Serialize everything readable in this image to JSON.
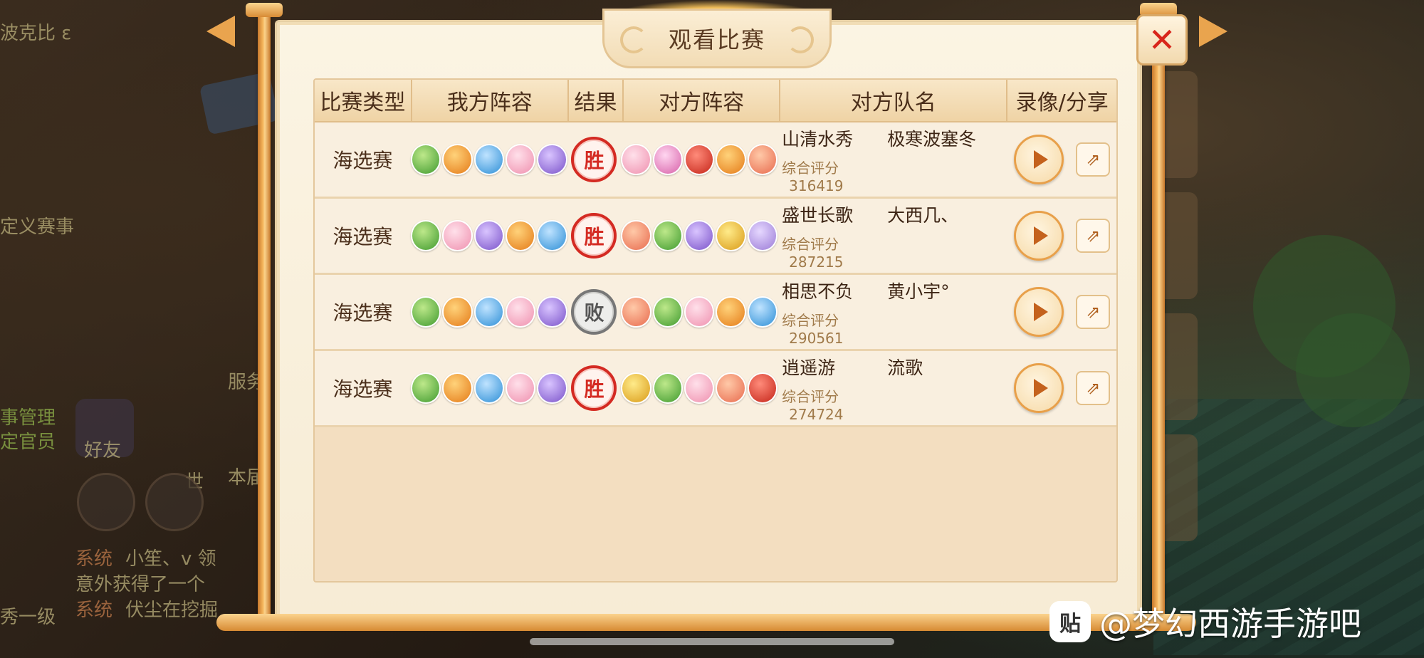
{
  "dialog": {
    "title": "观看比赛",
    "close_label": "✕"
  },
  "table": {
    "headers": [
      "比赛类型",
      "我方阵容",
      "结果",
      "对方阵容",
      "对方队名",
      "录像/分享"
    ],
    "rows": [
      {
        "type": "海选赛",
        "my_team": [
          "green",
          "orange",
          "blue",
          "pink",
          "purple"
        ],
        "result": "胜",
        "opp_team": [
          "pink",
          "magenta",
          "red",
          "orange",
          "salmon"
        ],
        "opp_player1": "山清水秀",
        "opp_player2": "极寒波塞冬",
        "score_label": "综合评分",
        "score": "316419"
      },
      {
        "type": "海选赛",
        "my_team": [
          "green",
          "pink",
          "purple",
          "orange",
          "blue"
        ],
        "result": "胜",
        "opp_team": [
          "salmon",
          "green",
          "purple",
          "yellow",
          "violet"
        ],
        "opp_player1": "盛世长歌",
        "opp_player2": "大西几、",
        "score_label": "综合评分",
        "score": "287215"
      },
      {
        "type": "海选赛",
        "my_team": [
          "green",
          "orange",
          "blue",
          "pink",
          "purple"
        ],
        "result": "败",
        "opp_team": [
          "salmon",
          "green",
          "pink",
          "orange",
          "blue"
        ],
        "opp_player1": "相思不负",
        "opp_player2": "黄小宇°",
        "score_label": "综合评分",
        "score": "290561"
      },
      {
        "type": "海选赛",
        "my_team": [
          "green",
          "orange",
          "blue",
          "pink",
          "purple"
        ],
        "result": "胜",
        "opp_team": [
          "yellow",
          "green",
          "pink",
          "salmon",
          "red"
        ],
        "opp_player1": "逍遥游",
        "opp_player2": "流歌",
        "score_label": "综合评分",
        "score": "274724"
      }
    ]
  },
  "watermark": {
    "logo": "贴",
    "text": "@梦幻西游手游吧"
  },
  "background_text": {
    "custom_event": "定义赛事",
    "friend": "好友",
    "server": "服务",
    "world": "世",
    "this_session": "本届",
    "system1": "系统",
    "chat1": "小笙、v 领",
    "chat2": "意外获得了一个",
    "system2": "系统",
    "chat3": "伏尘在挖掘",
    "affairs": "事管理",
    "official": "定官员",
    "top_text": "波克比 ε",
    "elite": "秀一级"
  }
}
